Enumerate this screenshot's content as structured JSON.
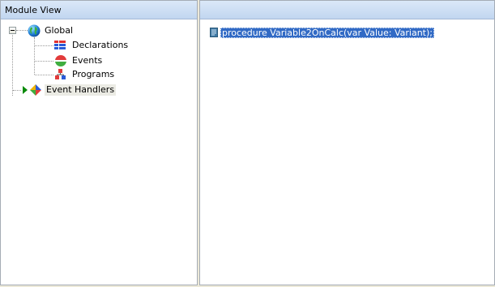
{
  "left_panel": {
    "header": "Module View",
    "tree": {
      "global": "Global",
      "declarations": "Declarations",
      "events": "Events",
      "programs": "Programs",
      "event_handlers": "Event Handlers"
    }
  },
  "right_panel": {
    "code_line": "procedure Variable2OnCalc(var Value: Variant);"
  },
  "colors": {
    "selection": "#316ac5",
    "header_gradient": "#c1d6f0",
    "event_handlers_arrow": "#0a8a0a"
  },
  "icons": {
    "global": "globe-icon",
    "declarations": "declarations-icon",
    "events": "events-icon",
    "programs": "programs-icon",
    "event_handlers": "event-handlers-icon",
    "code": "procedure-icon"
  }
}
